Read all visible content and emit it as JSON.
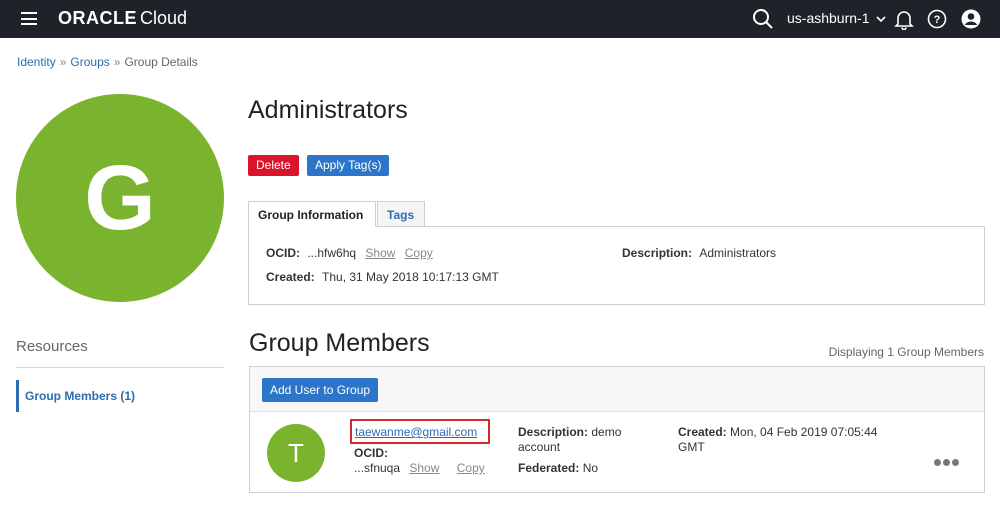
{
  "header": {
    "brand_bold": "ORACLE",
    "brand_light": "Cloud",
    "region": "us-ashburn-1"
  },
  "breadcrumb": {
    "items": [
      "Identity",
      "Groups",
      "Group Details"
    ],
    "separator": "»"
  },
  "group": {
    "avatar_letter": "G",
    "name": "Administrators",
    "delete_label": "Delete",
    "apply_tags_label": "Apply Tag(s)"
  },
  "tabs": [
    {
      "label": "Group Information",
      "active": true
    },
    {
      "label": "Tags",
      "active": false
    }
  ],
  "info": {
    "ocid_label": "OCID:",
    "ocid_value": "...hfw6hq",
    "show_label": "Show",
    "copy_label": "Copy",
    "description_label": "Description:",
    "description_value": "Administrators",
    "created_label": "Created:",
    "created_value": "Thu, 31 May 2018 10:17:13 GMT"
  },
  "resources": {
    "title": "Resources",
    "items": [
      {
        "label": "Group Members (1)"
      }
    ]
  },
  "members": {
    "title": "Group Members",
    "displaying": "Displaying 1 Group Members",
    "add_user_label": "Add User to Group",
    "list": [
      {
        "avatar_letter": "T",
        "email": "taewanme@gmail.com",
        "ocid_label": "OCID:",
        "ocid_value": "...sfnuqa",
        "show_label": "Show",
        "copy_label": "Copy",
        "description_label": "Description:",
        "description_line1": "demo",
        "description_line2": "account",
        "federated_label": "Federated:",
        "federated_value": "No",
        "created_label": "Created:",
        "created_line1": "Mon, 04 Feb 2019 07:05:44",
        "created_line2": "GMT"
      }
    ]
  },
  "colors": {
    "topbar": "#1e2329",
    "avatar_green": "#7ab32e",
    "link_blue": "#2c6cb0",
    "delete_red": "#d9152b",
    "highlight_red": "#d42a2a"
  },
  "icons": [
    "hamburger-menu-icon",
    "search-icon",
    "chevron-down-icon",
    "bell-icon",
    "help-icon",
    "user-profile-icon",
    "more-actions-icon"
  ]
}
